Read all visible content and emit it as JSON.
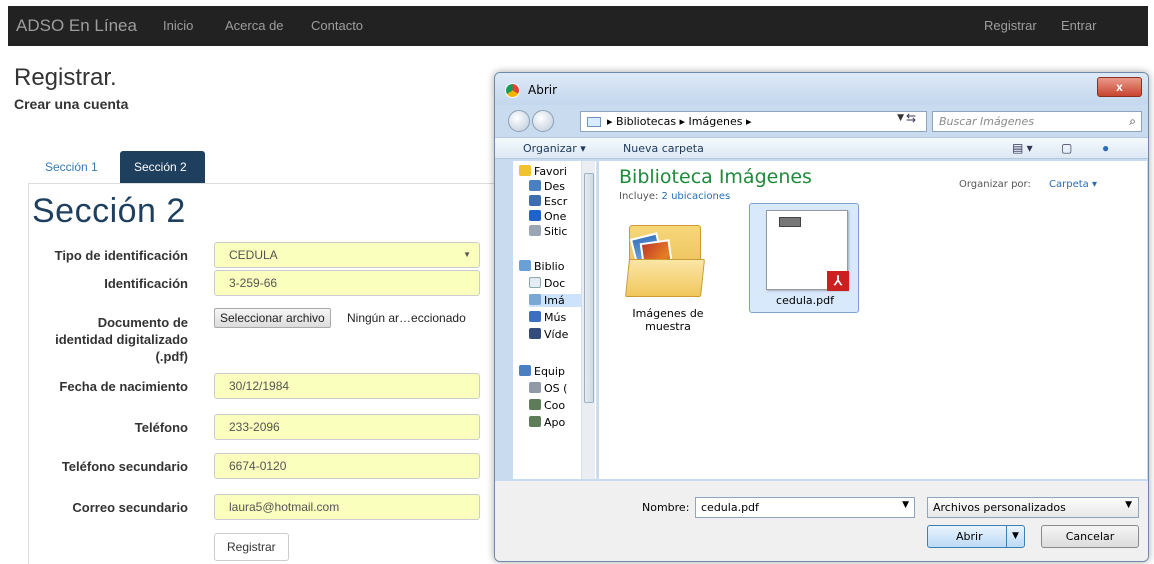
{
  "navbar": {
    "brand": "ADSO En Línea",
    "links": [
      "Inicio",
      "Acerca de",
      "Contacto"
    ],
    "right_links": [
      "Registrar",
      "Entrar"
    ]
  },
  "page": {
    "title": "Registrar.",
    "subtitle": "Crear una cuenta"
  },
  "tabs": [
    {
      "label": "Sección 1",
      "active": false
    },
    {
      "label": "Sección 2",
      "active": true
    }
  ],
  "form": {
    "section_title": "Sección 2",
    "fields": [
      {
        "label": "Tipo de identificación",
        "value": "CEDULA",
        "type": "select"
      },
      {
        "label": "Identificación",
        "value": "3-259-66",
        "type": "text"
      },
      {
        "label_lines": [
          "Documento de",
          "identidad digitalizado",
          "(.pdf)"
        ],
        "button": "Seleccionar archivo",
        "status": "Ningún ar…eccionado",
        "type": "file"
      },
      {
        "label": "Fecha de nacimiento",
        "value": "30/12/1984",
        "type": "text"
      },
      {
        "label": "Teléfono",
        "value": "233-2096",
        "type": "text"
      },
      {
        "label": "Teléfono secundario",
        "value": "6674-0120",
        "type": "text"
      },
      {
        "label": "Correo secundario",
        "value": "laura5@hotmail.com",
        "type": "text"
      }
    ],
    "submit_label": "Registrar"
  },
  "dialog": {
    "title": "Abrir",
    "close_label": "x",
    "breadcrumb": "▸ Bibliotecas ▸ Imágenes ▸",
    "search_placeholder": "Buscar Imágenes",
    "toolbar": {
      "organize": "Organizar ▾",
      "new_folder": "Nueva carpeta"
    },
    "nav_items": [
      "Favori",
      "Des",
      "Escr",
      "One",
      "Sitic",
      "Biblio",
      "Doc",
      "Imá",
      "Mús",
      "Víde",
      "Equip",
      "OS (",
      "Coo",
      "Apo"
    ],
    "library": {
      "title": "Biblioteca Imágenes",
      "includes_label": "Incluye:",
      "includes_link": "2 ubicaciones",
      "arrange_label": "Organizar por:",
      "arrange_value": "Carpeta ▾"
    },
    "items": [
      {
        "label_lines": [
          "Imágenes de",
          "muestra"
        ],
        "kind": "folder"
      },
      {
        "label_lines": [
          "cedula.pdf"
        ],
        "kind": "pdf",
        "selected": true
      }
    ],
    "filename_label": "Nombre:",
    "filename": "cedula.pdf",
    "filter": "Archivos personalizados",
    "open_label": "Abrir",
    "cancel_label": "Cancelar"
  },
  "colors": {
    "navbar_bg": "#222222",
    "active_tab": "#1f3f5f",
    "autofill_yellow": "#faffbd",
    "library_title": "#1f8a3c"
  }
}
